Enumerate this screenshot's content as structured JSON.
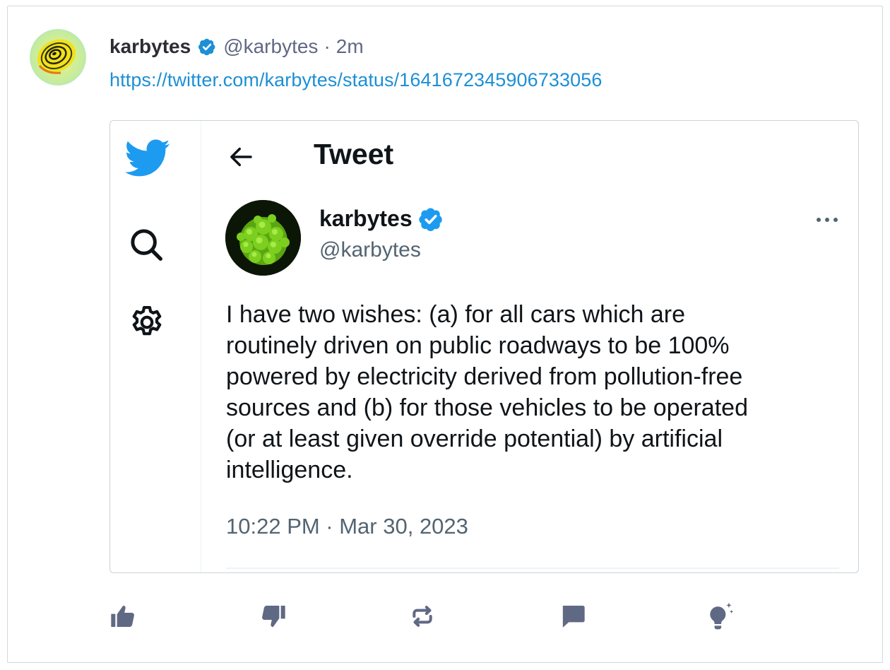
{
  "post": {
    "author_name": "karbytes",
    "author_handle": "@karbytes",
    "separator": "·",
    "time": "2m",
    "link": "https://twitter.com/karbytes/status/1641672345906733056",
    "avatar_icon": "spiral-avatar"
  },
  "embedded_tweet": {
    "header_title": "Tweet",
    "name": "karbytes",
    "handle": "@karbytes",
    "text": "I have two wishes: (a) for all cars which are\nroutinely driven on public roadways to be 100%\npowered by electricity derived from pollution-free\nsources and (b) for those vehicles to be operated\n(or at least given override potential) by artificial\nintelligence.",
    "timestamp": "10:22 PM · Mar 30, 2023",
    "sidebar_icons": [
      "twitter-bird-icon",
      "search-icon",
      "settings-gear-icon"
    ],
    "avatar_icon": "romanesco-broccoli-avatar"
  },
  "actions": [
    {
      "icon": "thumbs-up-icon"
    },
    {
      "icon": "thumbs-down-icon"
    },
    {
      "icon": "repost-icon"
    },
    {
      "icon": "reply-icon"
    },
    {
      "icon": "lightbulb-sparkle-icon"
    }
  ],
  "colors": {
    "link": "#1d8fd6",
    "verified": "#1d9bf0",
    "muted": "#606984",
    "action_icon": "#606984",
    "border": "#cfd9e0"
  }
}
